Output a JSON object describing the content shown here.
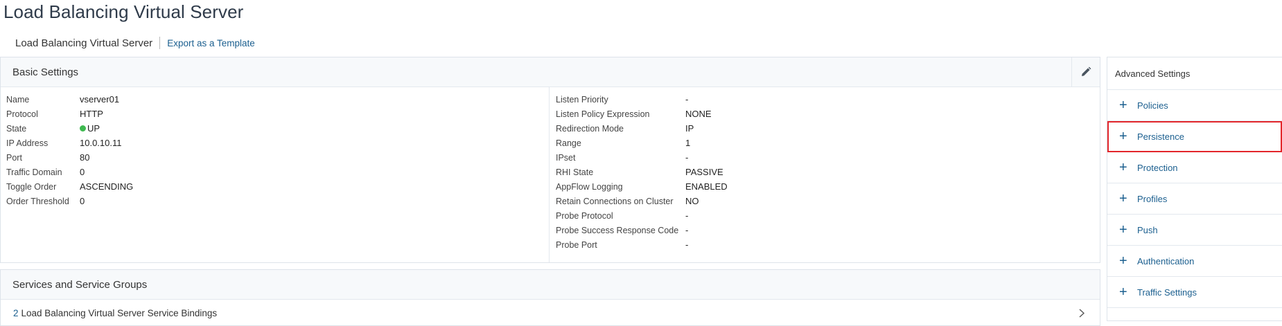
{
  "page": {
    "title": "Load Balancing Virtual Server"
  },
  "breadcrumb": {
    "current": "Load Balancing Virtual Server",
    "export_link": "Export as a Template"
  },
  "basic_settings": {
    "title": "Basic Settings",
    "left": [
      {
        "label": "Name",
        "value": "vserver01"
      },
      {
        "label": "Protocol",
        "value": "HTTP"
      },
      {
        "label": "State",
        "value": "UP",
        "status_color": "#3fb950"
      },
      {
        "label": "IP Address",
        "value": "10.0.10.11"
      },
      {
        "label": "Port",
        "value": "80"
      },
      {
        "label": "Traffic Domain",
        "value": "0"
      },
      {
        "label": "Toggle Order",
        "value": "ASCENDING"
      },
      {
        "label": "Order Threshold",
        "value": "0"
      }
    ],
    "right": [
      {
        "label": "Listen Priority",
        "value": "-"
      },
      {
        "label": "Listen Policy Expression",
        "value": "NONE"
      },
      {
        "label": "Redirection Mode",
        "value": "IP"
      },
      {
        "label": "Range",
        "value": "1"
      },
      {
        "label": "IPset",
        "value": "-"
      },
      {
        "label": "RHI State",
        "value": "PASSIVE"
      },
      {
        "label": "AppFlow Logging",
        "value": "ENABLED"
      },
      {
        "label": "Retain Connections on Cluster",
        "value": "NO"
      },
      {
        "label": "Probe Protocol",
        "value": "-"
      },
      {
        "label": "Probe Success Response Code",
        "value": "-"
      },
      {
        "label": "Probe Port",
        "value": "-"
      }
    ]
  },
  "services": {
    "title": "Services and Service Groups",
    "binding_count": "2",
    "binding_label": "Load Balancing Virtual Server Service Bindings"
  },
  "advanced_settings": {
    "title": "Advanced Settings",
    "items": [
      {
        "label": "Policies"
      },
      {
        "label": "Persistence",
        "highlighted": true
      },
      {
        "label": "Protection"
      },
      {
        "label": "Profiles"
      },
      {
        "label": "Push"
      },
      {
        "label": "Authentication"
      },
      {
        "label": "Traffic Settings"
      }
    ]
  },
  "icons": {
    "edit": "pencil-icon",
    "add": "plus-icon",
    "chevron": "chevron-right-icon"
  },
  "colors": {
    "link": "#1b5f8f",
    "highlight_border": "#e3262b",
    "status_up": "#3fb950"
  }
}
